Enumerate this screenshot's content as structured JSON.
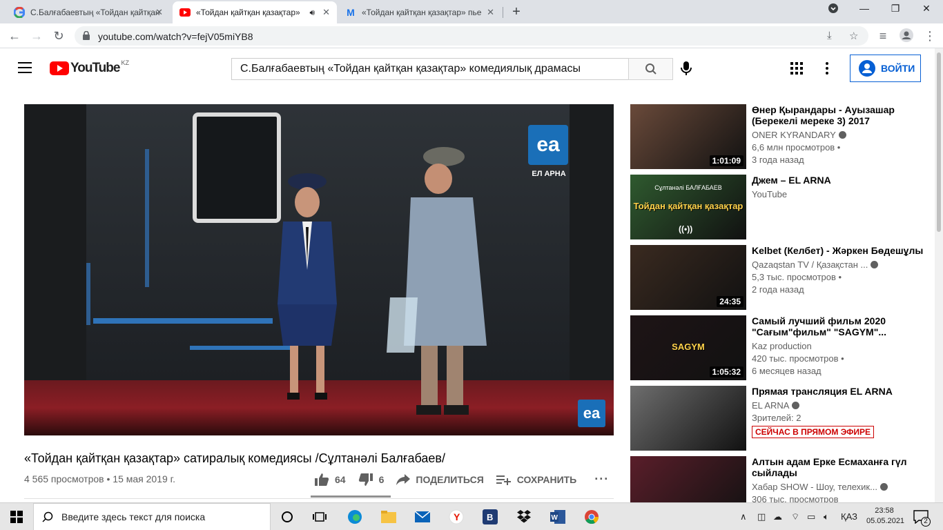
{
  "browser": {
    "tabs": [
      {
        "title": "С.Балғабаевтың «Тойдан қайтқан",
        "favicon": "google-icon",
        "active": false
      },
      {
        "title": "«Тойдан қайтқан қазақтар»",
        "favicon": "youtube-icon",
        "active": true
      },
      {
        "title": "«Тойдан қайтқан қазақтар» пье",
        "favicon": "mail-icon",
        "active": false
      }
    ],
    "url": "youtube.com/watch?v=fejV05miYB8"
  },
  "youtube": {
    "logo_text": "YouTube",
    "region": "KZ",
    "search_value": "С.Балғабаевтың «Тойдан  қайтқан  қазақтар» комедиялық драмасы",
    "signin_label": "ВОЙТИ"
  },
  "video": {
    "channel_logo_text": "ЕЛ АРНА",
    "title": "«Тойдан қайтқан қазақтар» сатиралық комедиясы /Сұлтанәлі Балғабаев/",
    "views": "4 565 просмотров",
    "date": "15 мая 2019 г.",
    "likes": "64",
    "dislikes": "6",
    "like_ratio": 0.914,
    "share_label": "ПОДЕЛИТЬСЯ",
    "save_label": "СОХРАНИТЬ"
  },
  "recommendations": [
    {
      "title": "Өнер Қырандары - Ауызашар (Берекелі мереке 3) 2017",
      "channel": "ONER KYRANDARY",
      "verified": true,
      "views": "6,6 млн просмотров •",
      "age": "3 года назад",
      "duration": "1:01:09",
      "thumb_color": "#6a4a3a"
    },
    {
      "title": "Джем – EL ARNA",
      "channel": "YouTube",
      "verified": false,
      "views": "",
      "age": "",
      "duration": "",
      "thumb_color": "#2f5a2f",
      "overlay_title": "Тойдан қайтқан қазақтар",
      "overlay_author": "Сұлтанәлі БАЛҒАБАЕВ"
    },
    {
      "title": "Kelbet (Келбет) - Жәркен Бөдешұлы",
      "channel": "Qazaqstan TV / Қазақстан ...",
      "verified": true,
      "views": "5,3 тыс. просмотров •",
      "age": "2 года назад",
      "duration": "24:35",
      "thumb_color": "#3a2a20"
    },
    {
      "title": "Самый лучший фильм 2020 \"Сағым\"фильм\" \"SAGYM\"...",
      "channel": "Kaz production",
      "verified": false,
      "views": "420 тыс. просмотров •",
      "age": "6 месяцев назад",
      "duration": "1:05:32",
      "thumb_color": "#1e1416",
      "overlay_title": "SAGYM"
    },
    {
      "title": "Прямая трансляция EL ARNA",
      "channel": "EL ARNA",
      "verified": true,
      "views": "Зрителей: 2",
      "age": "",
      "duration": "",
      "thumb_color": "#6e6e6e",
      "live": "СЕЙЧАС В ПРЯМОМ ЭФИРЕ"
    },
    {
      "title": "Алтын адам Ерке Есмаханға гүл сыйлады",
      "channel": "Хабар SHOW - Шоу, телехик...",
      "verified": true,
      "views": "306 тыс. просмотров",
      "age": "",
      "duration": "",
      "thumb_color": "#5a1e2a"
    }
  ],
  "taskbar": {
    "search_placeholder": "Введите здесь текст для поиска",
    "lang": "ҚАЗ",
    "time": "23:58",
    "date": "05.05.2021",
    "notifications": "2"
  },
  "colors": {
    "youtube_red": "#ff0000",
    "link_blue": "#065fd4",
    "live_red": "#cc0000"
  }
}
